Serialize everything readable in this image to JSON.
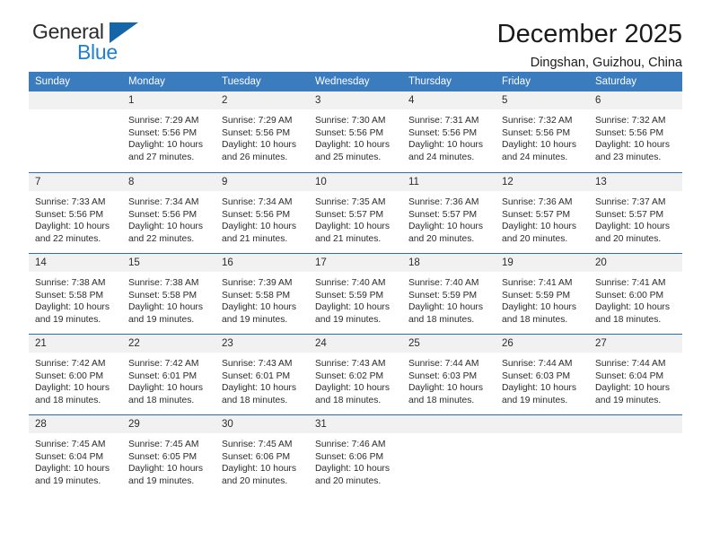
{
  "brand": {
    "name_top": "General",
    "name_bottom": "Blue",
    "triangle_color": "#1466a8",
    "blue_color": "#1f7fd0"
  },
  "header": {
    "title": "December 2025",
    "subtitle": "Dingshan, Guizhou, China"
  },
  "theme": {
    "header_bar": "#3a7cbe",
    "row_rule": "#2f6ead",
    "day_band": "#f1f1f1",
    "text": "#2b2b2b"
  },
  "weekdays": [
    "Sunday",
    "Monday",
    "Tuesday",
    "Wednesday",
    "Thursday",
    "Friday",
    "Saturday"
  ],
  "weeks": [
    [
      {
        "day": "",
        "sunrise": "",
        "sunset": "",
        "daylight1": "",
        "daylight2": ""
      },
      {
        "day": "1",
        "sunrise": "Sunrise: 7:29 AM",
        "sunset": "Sunset: 5:56 PM",
        "daylight1": "Daylight: 10 hours",
        "daylight2": "and 27 minutes."
      },
      {
        "day": "2",
        "sunrise": "Sunrise: 7:29 AM",
        "sunset": "Sunset: 5:56 PM",
        "daylight1": "Daylight: 10 hours",
        "daylight2": "and 26 minutes."
      },
      {
        "day": "3",
        "sunrise": "Sunrise: 7:30 AM",
        "sunset": "Sunset: 5:56 PM",
        "daylight1": "Daylight: 10 hours",
        "daylight2": "and 25 minutes."
      },
      {
        "day": "4",
        "sunrise": "Sunrise: 7:31 AM",
        "sunset": "Sunset: 5:56 PM",
        "daylight1": "Daylight: 10 hours",
        "daylight2": "and 24 minutes."
      },
      {
        "day": "5",
        "sunrise": "Sunrise: 7:32 AM",
        "sunset": "Sunset: 5:56 PM",
        "daylight1": "Daylight: 10 hours",
        "daylight2": "and 24 minutes."
      },
      {
        "day": "6",
        "sunrise": "Sunrise: 7:32 AM",
        "sunset": "Sunset: 5:56 PM",
        "daylight1": "Daylight: 10 hours",
        "daylight2": "and 23 minutes."
      }
    ],
    [
      {
        "day": "7",
        "sunrise": "Sunrise: 7:33 AM",
        "sunset": "Sunset: 5:56 PM",
        "daylight1": "Daylight: 10 hours",
        "daylight2": "and 22 minutes."
      },
      {
        "day": "8",
        "sunrise": "Sunrise: 7:34 AM",
        "sunset": "Sunset: 5:56 PM",
        "daylight1": "Daylight: 10 hours",
        "daylight2": "and 22 minutes."
      },
      {
        "day": "9",
        "sunrise": "Sunrise: 7:34 AM",
        "sunset": "Sunset: 5:56 PM",
        "daylight1": "Daylight: 10 hours",
        "daylight2": "and 21 minutes."
      },
      {
        "day": "10",
        "sunrise": "Sunrise: 7:35 AM",
        "sunset": "Sunset: 5:57 PM",
        "daylight1": "Daylight: 10 hours",
        "daylight2": "and 21 minutes."
      },
      {
        "day": "11",
        "sunrise": "Sunrise: 7:36 AM",
        "sunset": "Sunset: 5:57 PM",
        "daylight1": "Daylight: 10 hours",
        "daylight2": "and 20 minutes."
      },
      {
        "day": "12",
        "sunrise": "Sunrise: 7:36 AM",
        "sunset": "Sunset: 5:57 PM",
        "daylight1": "Daylight: 10 hours",
        "daylight2": "and 20 minutes."
      },
      {
        "day": "13",
        "sunrise": "Sunrise: 7:37 AM",
        "sunset": "Sunset: 5:57 PM",
        "daylight1": "Daylight: 10 hours",
        "daylight2": "and 20 minutes."
      }
    ],
    [
      {
        "day": "14",
        "sunrise": "Sunrise: 7:38 AM",
        "sunset": "Sunset: 5:58 PM",
        "daylight1": "Daylight: 10 hours",
        "daylight2": "and 19 minutes."
      },
      {
        "day": "15",
        "sunrise": "Sunrise: 7:38 AM",
        "sunset": "Sunset: 5:58 PM",
        "daylight1": "Daylight: 10 hours",
        "daylight2": "and 19 minutes."
      },
      {
        "day": "16",
        "sunrise": "Sunrise: 7:39 AM",
        "sunset": "Sunset: 5:58 PM",
        "daylight1": "Daylight: 10 hours",
        "daylight2": "and 19 minutes."
      },
      {
        "day": "17",
        "sunrise": "Sunrise: 7:40 AM",
        "sunset": "Sunset: 5:59 PM",
        "daylight1": "Daylight: 10 hours",
        "daylight2": "and 19 minutes."
      },
      {
        "day": "18",
        "sunrise": "Sunrise: 7:40 AM",
        "sunset": "Sunset: 5:59 PM",
        "daylight1": "Daylight: 10 hours",
        "daylight2": "and 18 minutes."
      },
      {
        "day": "19",
        "sunrise": "Sunrise: 7:41 AM",
        "sunset": "Sunset: 5:59 PM",
        "daylight1": "Daylight: 10 hours",
        "daylight2": "and 18 minutes."
      },
      {
        "day": "20",
        "sunrise": "Sunrise: 7:41 AM",
        "sunset": "Sunset: 6:00 PM",
        "daylight1": "Daylight: 10 hours",
        "daylight2": "and 18 minutes."
      }
    ],
    [
      {
        "day": "21",
        "sunrise": "Sunrise: 7:42 AM",
        "sunset": "Sunset: 6:00 PM",
        "daylight1": "Daylight: 10 hours",
        "daylight2": "and 18 minutes."
      },
      {
        "day": "22",
        "sunrise": "Sunrise: 7:42 AM",
        "sunset": "Sunset: 6:01 PM",
        "daylight1": "Daylight: 10 hours",
        "daylight2": "and 18 minutes."
      },
      {
        "day": "23",
        "sunrise": "Sunrise: 7:43 AM",
        "sunset": "Sunset: 6:01 PM",
        "daylight1": "Daylight: 10 hours",
        "daylight2": "and 18 minutes."
      },
      {
        "day": "24",
        "sunrise": "Sunrise: 7:43 AM",
        "sunset": "Sunset: 6:02 PM",
        "daylight1": "Daylight: 10 hours",
        "daylight2": "and 18 minutes."
      },
      {
        "day": "25",
        "sunrise": "Sunrise: 7:44 AM",
        "sunset": "Sunset: 6:03 PM",
        "daylight1": "Daylight: 10 hours",
        "daylight2": "and 18 minutes."
      },
      {
        "day": "26",
        "sunrise": "Sunrise: 7:44 AM",
        "sunset": "Sunset: 6:03 PM",
        "daylight1": "Daylight: 10 hours",
        "daylight2": "and 19 minutes."
      },
      {
        "day": "27",
        "sunrise": "Sunrise: 7:44 AM",
        "sunset": "Sunset: 6:04 PM",
        "daylight1": "Daylight: 10 hours",
        "daylight2": "and 19 minutes."
      }
    ],
    [
      {
        "day": "28",
        "sunrise": "Sunrise: 7:45 AM",
        "sunset": "Sunset: 6:04 PM",
        "daylight1": "Daylight: 10 hours",
        "daylight2": "and 19 minutes."
      },
      {
        "day": "29",
        "sunrise": "Sunrise: 7:45 AM",
        "sunset": "Sunset: 6:05 PM",
        "daylight1": "Daylight: 10 hours",
        "daylight2": "and 19 minutes."
      },
      {
        "day": "30",
        "sunrise": "Sunrise: 7:45 AM",
        "sunset": "Sunset: 6:06 PM",
        "daylight1": "Daylight: 10 hours",
        "daylight2": "and 20 minutes."
      },
      {
        "day": "31",
        "sunrise": "Sunrise: 7:46 AM",
        "sunset": "Sunset: 6:06 PM",
        "daylight1": "Daylight: 10 hours",
        "daylight2": "and 20 minutes."
      },
      {
        "day": "",
        "sunrise": "",
        "sunset": "",
        "daylight1": "",
        "daylight2": ""
      },
      {
        "day": "",
        "sunrise": "",
        "sunset": "",
        "daylight1": "",
        "daylight2": ""
      },
      {
        "day": "",
        "sunrise": "",
        "sunset": "",
        "daylight1": "",
        "daylight2": ""
      }
    ]
  ]
}
